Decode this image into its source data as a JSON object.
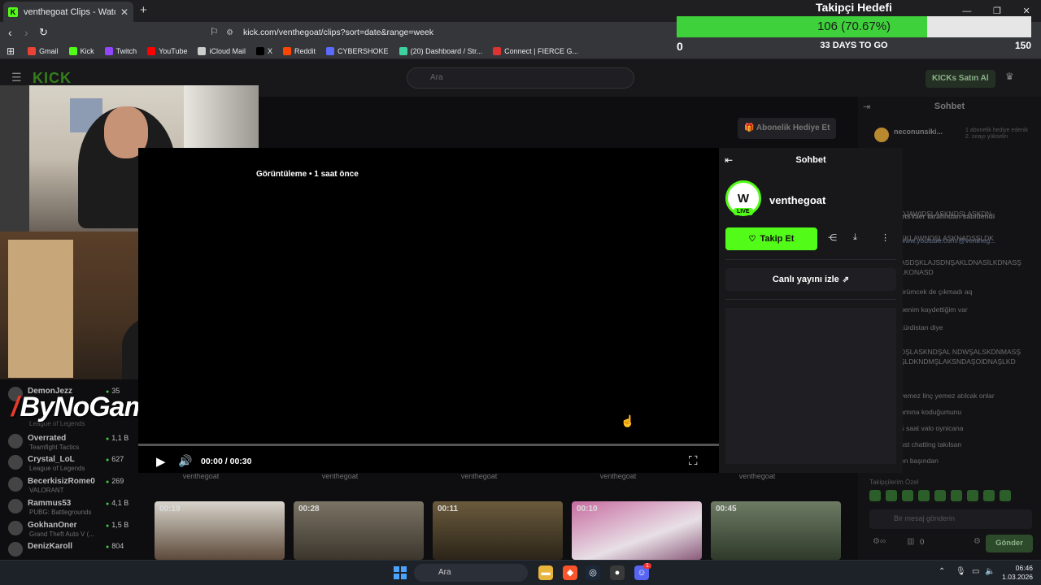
{
  "browser": {
    "tab_title": "venthegoat Clips - Watch Liv",
    "tab_favicon": "K",
    "url": "kick.com/venthegoat/clips?sort=date&range=week",
    "bookmarks": [
      {
        "label": "Gmail",
        "color": "#ea4335"
      },
      {
        "label": "Kick",
        "color": "#53fc18"
      },
      {
        "label": "Twitch",
        "color": "#9146ff"
      },
      {
        "label": "YouTube",
        "color": "#ff0000"
      },
      {
        "label": "iCloud Mail",
        "color": "#cccccc"
      },
      {
        "label": "X",
        "color": "#000000"
      },
      {
        "label": "Reddit",
        "color": "#ff4500"
      },
      {
        "label": "CYBERSHOKE",
        "color": "#5b6bff"
      },
      {
        "label": "(20) Dashboard / Str...",
        "color": "#3fd1a0"
      },
      {
        "label": "Connect | FIERCE G...",
        "color": "#d33"
      }
    ]
  },
  "goal": {
    "title": "Takipçi Hedefi",
    "value_text": "106 (70.67%)",
    "progress": 0.7067,
    "min": "0",
    "max": "150",
    "days_left": "33 DAYS TO GO"
  },
  "kick": {
    "logo": "KICK",
    "search_placeholder": "Ara",
    "buy_kicks": "KICKs Satın Al",
    "gift_sub": "Abonelik Hediye Et",
    "streamers": [
      {
        "name": "DemonJezz",
        "viewers": "35",
        "game": ""
      },
      {
        "name": "Overrated",
        "viewers": "1,1 B",
        "game": "Teamfight Tactics"
      },
      {
        "name": "Crystal_LoL",
        "viewers": "627",
        "game": "League of Legends"
      },
      {
        "name": "BecerkisizRome0",
        "viewers": "269",
        "game": "VALORANT"
      },
      {
        "name": "Rammus53",
        "viewers": "4,1 B",
        "game": "PUBG: Battlegrounds"
      },
      {
        "name": "GokhanOner",
        "viewers": "1,5 B",
        "game": "Grand Theft Auto V (..."
      },
      {
        "name": "DenizKaroll",
        "viewers": "804",
        "game": ""
      }
    ],
    "streamer_sub_lol": "League of Legends",
    "overlay_logo": "ByNoGame"
  },
  "player": {
    "meta": "Görüntüleme • 1 saat önce",
    "time": "00:00 / 00:30",
    "progress": 0
  },
  "clip_panel": {
    "title": "Sohbet",
    "channel": "venthegoat",
    "avatar": "W",
    "live": "LIVE",
    "follow": "Takip Et",
    "watch_live": "Canlı yayını izle"
  },
  "chat": {
    "title": "Sohbet",
    "pinned_user": "neconunsiki...",
    "pinned_text": "1 abonelik hediye edenik 2. sırayı yükselin",
    "pinned_by": "otsVaer tarafından sabitlendi",
    "link": "www.youtube.com/@ventheg...",
    "lines": [
      "DJAWIDŞLASKNDŞLASKDN",
      "ŞKLAWNDŞLASKNADŞŞLDK",
      "ASDŞKLAJSDNŞAKLDNASİLKDNASŞ LKONASD",
      "örümcek de çıkmadı aq",
      "benim kaydettiğim var",
      "kürdistan diye",
      "DŞLASKNDŞAL NDWŞALSKDNMASŞ ŞLDKNDMŞLAKSNDAŞOIDNAŞLKD",
      "yemez linç yemez atılcak onlar",
      "amına koduğumunu",
      "5 saat valo oynicana",
      "ust chatting takılsan",
      "en başından"
    ],
    "emote_label": "Takipçilerim Özel",
    "input_placeholder": "Bir mesaj gönderin",
    "kicks_count": "0",
    "send": "Gönder"
  },
  "clips": [
    {
      "channel": "venthegoat",
      "duration": "00:19"
    },
    {
      "channel": "venthegoat",
      "duration": "00:28"
    },
    {
      "channel": "venthegoat",
      "duration": "00:11"
    },
    {
      "channel": "venthegoat",
      "duration": "00:10"
    },
    {
      "channel": "venthegoat",
      "duration": "00:45"
    }
  ],
  "taskbar": {
    "search": "Ara",
    "time": "06:46",
    "date": "1.03.2026",
    "discord_badge": "1"
  }
}
